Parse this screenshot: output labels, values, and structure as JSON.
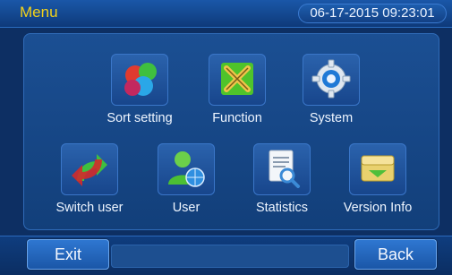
{
  "header": {
    "title": "Menu",
    "datetime": "06-17-2015 09:23:01"
  },
  "menu": {
    "items": [
      {
        "label": "Sort setting",
        "icon": "color-balls-icon"
      },
      {
        "label": "Function",
        "icon": "tools-icon"
      },
      {
        "label": "System",
        "icon": "gear-icon"
      },
      {
        "label": "Switch user",
        "icon": "switch-user-icon"
      },
      {
        "label": "User",
        "icon": "user-globe-icon"
      },
      {
        "label": "Statistics",
        "icon": "statistics-document-icon"
      },
      {
        "label": "Version Info",
        "icon": "version-box-icon"
      }
    ]
  },
  "footer": {
    "exit_label": "Exit",
    "back_label": "Back"
  },
  "colors": {
    "background": "#0d2f63",
    "title": "#f2d21a",
    "button": "#2f78d2"
  }
}
